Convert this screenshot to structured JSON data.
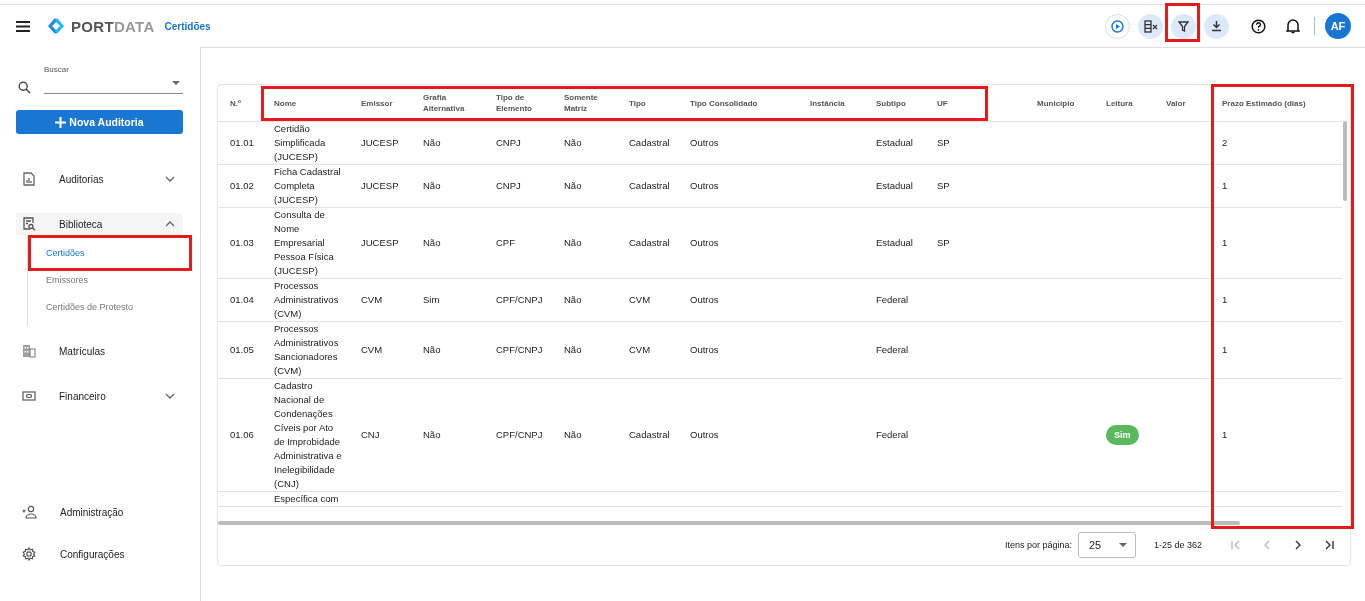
{
  "topbar": {
    "brand": {
      "part1": "PORT",
      "part2": "DATA"
    },
    "breadcrumb": "Certidões",
    "avatar": "AF"
  },
  "sidebar": {
    "search": {
      "label": "Buscar"
    },
    "new_button": "Nova Auditoria",
    "items": [
      {
        "label": "Auditorias",
        "kind": "report",
        "expandable": true,
        "expanded": false
      },
      {
        "label": "Biblioteca",
        "kind": "library",
        "expandable": true,
        "expanded": true,
        "children": [
          {
            "label": "Certidões",
            "selected": true
          },
          {
            "label": "Emissores",
            "selected": false
          },
          {
            "label": "Certidões de Protesto",
            "selected": false
          }
        ]
      },
      {
        "label": "Matrículas",
        "kind": "building",
        "expandable": false
      },
      {
        "label": "Financeiro",
        "kind": "money",
        "expandable": true,
        "expanded": false
      }
    ],
    "bottom_items": [
      {
        "label": "Administração",
        "kind": "admin"
      },
      {
        "label": "Configurações",
        "kind": "gear"
      }
    ]
  },
  "table": {
    "columns": [
      "N.º",
      "Nome",
      "Emissor",
      "Grafia Alternativa",
      "Tipo de Elemento",
      "Somente Matriz",
      "Tipo",
      "Tipo Consolidado",
      "Instância",
      "Subtipo",
      "UF",
      "Município",
      "Leitura",
      "Valor",
      "Prazo Estimado (dias)"
    ],
    "rows": [
      {
        "n": "01.01",
        "nome": "Certidão Simplificada (JUCESP)",
        "emissor": "JUCESP",
        "grafia": "Não",
        "elemento": "CNPJ",
        "matriz": "Não",
        "tipo": "Cadastral",
        "consolidado": "Outros",
        "instancia": "",
        "subtipo": "Estadual",
        "uf": "SP",
        "municipio": "",
        "leitura": "",
        "valor": "",
        "prazo": "2"
      },
      {
        "n": "01.02",
        "nome": "Ficha Cadastral Completa (JUCESP)",
        "emissor": "JUCESP",
        "grafia": "Não",
        "elemento": "CNPJ",
        "matriz": "Não",
        "tipo": "Cadastral",
        "consolidado": "Outros",
        "instancia": "",
        "subtipo": "Estadual",
        "uf": "SP",
        "municipio": "",
        "leitura": "",
        "valor": "",
        "prazo": "1"
      },
      {
        "n": "01.03",
        "nome": "Consulta de Nome Empresarial Pessoa Física (JUCESP)",
        "emissor": "JUCESP",
        "grafia": "Não",
        "elemento": "CPF",
        "matriz": "Não",
        "tipo": "Cadastral",
        "consolidado": "Outros",
        "instancia": "",
        "subtipo": "Estadual",
        "uf": "SP",
        "municipio": "",
        "leitura": "",
        "valor": "",
        "prazo": "1"
      },
      {
        "n": "01.04",
        "nome": "Processos Administrativos (CVM)",
        "emissor": "CVM",
        "grafia": "Sim",
        "elemento": "CPF/CNPJ",
        "matriz": "Não",
        "tipo": "CVM",
        "consolidado": "Outros",
        "instancia": "",
        "subtipo": "Federal",
        "uf": "",
        "municipio": "",
        "leitura": "",
        "valor": "",
        "prazo": "1"
      },
      {
        "n": "01.05",
        "nome": "Processos Administrativos Sancionadores (CVM)",
        "emissor": "CVM",
        "grafia": "Não",
        "elemento": "CPF/CNPJ",
        "matriz": "Não",
        "tipo": "CVM",
        "consolidado": "Outros",
        "instancia": "",
        "subtipo": "Federal",
        "uf": "",
        "municipio": "",
        "leitura": "",
        "valor": "",
        "prazo": "1"
      },
      {
        "n": "01.06",
        "nome": "Cadastro Nacional de Condenações Cíveis por Ato de Improbidade Administrativa e Inelegibilidade (CNJ)",
        "emissor": "CNJ",
        "grafia": "Não",
        "elemento": "CPF/CNPJ",
        "matriz": "Não",
        "tipo": "Cadastral",
        "consolidado": "Outros",
        "instancia": "",
        "subtipo": "Federal",
        "uf": "",
        "municipio": "",
        "leitura": "Sim",
        "valor": "",
        "prazo": "1"
      },
      {
        "n": "",
        "nome": "Específica com",
        "emissor": "",
        "grafia": "",
        "elemento": "",
        "matriz": "",
        "tipo": "",
        "consolidado": "",
        "instancia": "",
        "subtipo": "",
        "uf": "",
        "municipio": "",
        "leitura": "",
        "valor": "",
        "prazo": ""
      }
    ]
  },
  "pager": {
    "label": "Itens por página:",
    "page_size": "25",
    "range": "1-25 de 362",
    "nav": [
      {
        "kind": "first",
        "disabled": true
      },
      {
        "kind": "prev",
        "disabled": true
      },
      {
        "kind": "next",
        "disabled": false
      },
      {
        "kind": "last",
        "disabled": false
      }
    ]
  }
}
